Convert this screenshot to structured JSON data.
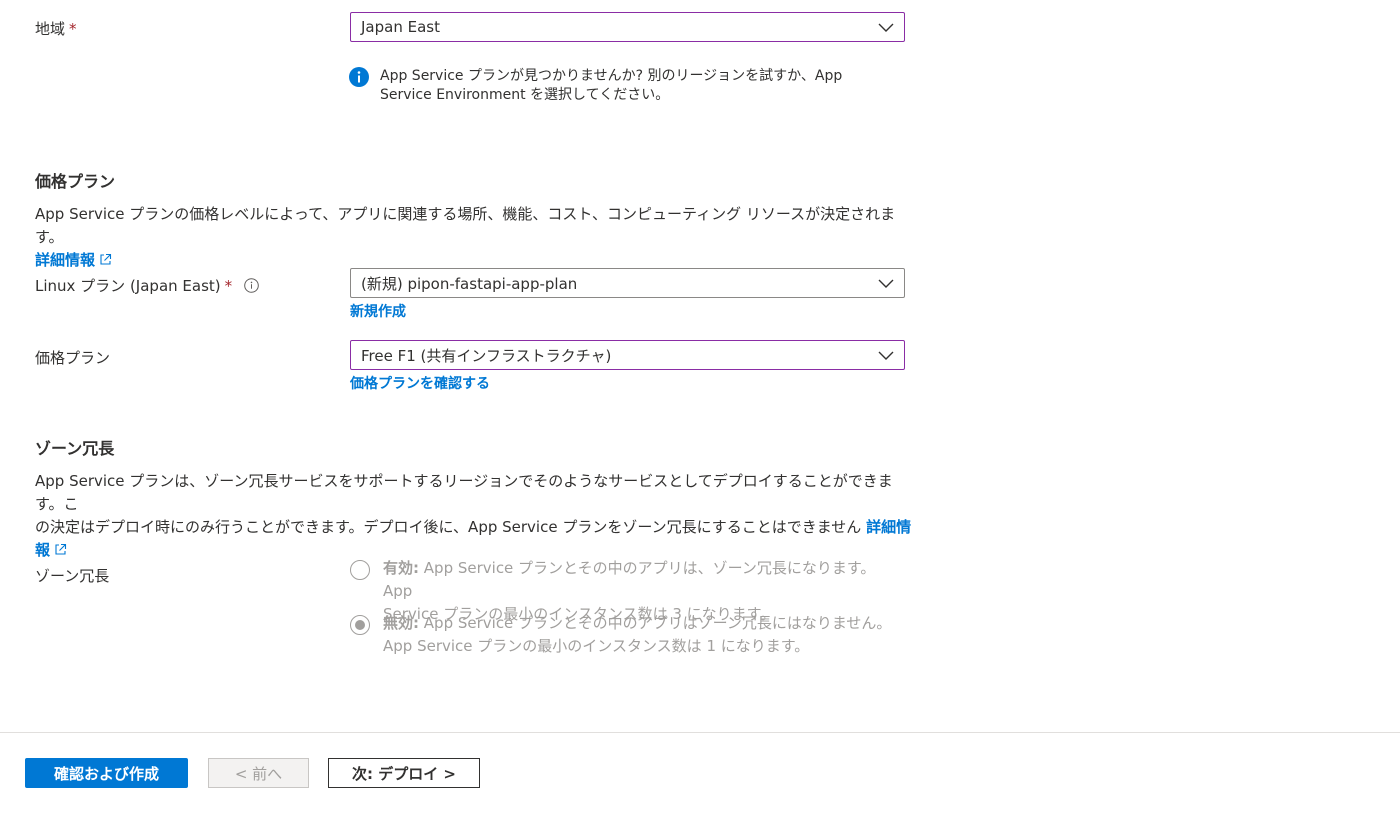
{
  "region": {
    "label": "地域",
    "required_mark": "*",
    "value": "Japan East",
    "info_line1": "App Service プランが見つかりませんか? 別のリージョンを試すか、App",
    "info_line2": "Service Environment を選択してください。"
  },
  "pricing_section": {
    "title": "価格プラン",
    "description": "App Service プランの価格レベルによって、アプリに関連する場所、機能、コスト、コンピューティング リソースが決定されます。",
    "learn_more": "詳細情報"
  },
  "linux_plan": {
    "label": "Linux プラン (Japan East)",
    "required_mark": "*",
    "value": "(新規) pipon-fastapi-app-plan",
    "create_new": "新規作成"
  },
  "pricing_plan": {
    "label": "価格プラン",
    "value": "Free F1 (共有インフラストラクチャ)",
    "explore_link": "価格プランを確認する"
  },
  "zone_section": {
    "title": "ゾーン冗長",
    "description_line1": "App Service プランは、ゾーン冗長サービスをサポートするリージョンでそのようなサービスとしてデプロイすることができます。こ",
    "description_line2": "の決定はデプロイ時にのみ行うことができます。デプロイ後に、App Service プランをゾーン冗長にすることはできません",
    "learn_more_part1": "詳細情",
    "learn_more_part2": "報"
  },
  "zone_redundancy": {
    "label": "ゾーン冗長",
    "options": [
      {
        "title": "有効:",
        "text_line1": "App Service プランとその中のアプリは、ゾーン冗長になります。App",
        "text_line2": "Service プランの最小のインスタンス数は 3 になります。",
        "selected": false
      },
      {
        "title": "無効:",
        "text_line1": "App Service プランとその中のアプリはゾーン冗長にはなりません。",
        "text_line2": "App Service プランの最小のインスタンス数は 1 になります。",
        "selected": true
      }
    ]
  },
  "footer": {
    "review_create": "確認および作成",
    "previous": "< 前へ",
    "next": "次: デプロイ >"
  },
  "colors": {
    "accent": "#0078d4",
    "focus_border": "#8a2da5",
    "required": "#a4262c",
    "disabled": "#a19f9d"
  },
  "icons": [
    "chevron-down-icon",
    "info-icon",
    "external-link-icon",
    "info-outline-icon"
  ]
}
